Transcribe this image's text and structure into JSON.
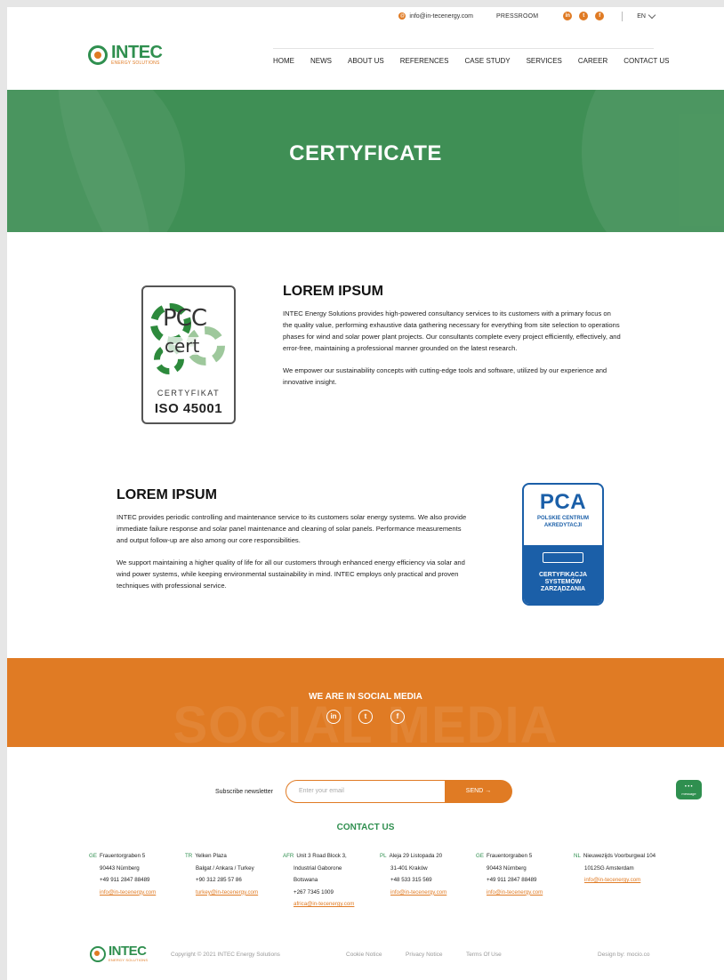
{
  "topbar": {
    "email": "info@in-tecenergy.com",
    "pressroom": "PRESSROOM",
    "social_icons": [
      "linkedin-icon",
      "twitter-icon",
      "facebook-icon"
    ],
    "language": "EN"
  },
  "logo": {
    "name": "INTEC",
    "tagline": "ENERGY SOLUTIONS"
  },
  "nav": [
    "HOME",
    "NEWS",
    "ABOUT US",
    "REFERENCES",
    "CASE STUDY",
    "SERVICES",
    "CAREER",
    "CONTACT US"
  ],
  "hero": {
    "title": "CERTYFICATE"
  },
  "cert_pcc": {
    "line1": "PCC",
    "line2": "cert",
    "label": "CERTYFIKAT",
    "standard": "ISO 45001"
  },
  "section1": {
    "heading": "LOREM IPSUM",
    "p1": "INTEC Energy Solutions provides high-powered consultancy services to its customers with a primary focus on the quality value, performing exhaustive data gathering necessary for everything from site selection to operations phases for wind and solar power plant projects. Our consultants complete every project efficiently, effectively, and error-free, maintaining a professional manner grounded on the latest research.",
    "p2": "We empower our sustainability concepts with cutting-edge tools and software, utilized by our experience and innovative insight."
  },
  "section2": {
    "heading": "LOREM IPSUM",
    "p1": "INTEC provides periodic controlling and maintenance service to its customers solar energy systems. We also provide immediate failure response and solar panel maintenance and cleaning of solar panels. Performance measurements and output follow-up are also among our core responsibilities.",
    "p2": "We support maintaining a higher quality of life for all our customers through enhanced energy efficiency via solar and wind power systems, while keeping environmental sustainability in mind. INTEC employs only practical and proven techniques with professional service."
  },
  "cert_pca": {
    "logo": "PCA",
    "name_line1": "POLSKIE CENTRUM",
    "name_line2": "AKREDYTACJI",
    "bottom_line1": "CERTYFIKACJA",
    "bottom_line2": "SYSTEMÓW",
    "bottom_line3": "ZARZĄDZANIA"
  },
  "social": {
    "background_text": "SOCIAL MEDIA",
    "title": "WE ARE IN SOCIAL MEDIA"
  },
  "newsletter": {
    "label": "Subscribe newsletter",
    "placeholder": "Enter your email",
    "button": "SEND →"
  },
  "chat": {
    "label": "message"
  },
  "contact": {
    "title": "CONTACT US",
    "offices": [
      {
        "code": "GE",
        "line1": "Frauentorgraben 5",
        "line2": "90443 Nürnberg",
        "line3": "+49 911 2847 88489",
        "email": "info@in-tecenergy.com"
      },
      {
        "code": "TR",
        "line1": "Yelken Plaza",
        "line2": "Balgat / Ankara / Turkey",
        "line3": "+90 312 285 57 86",
        "email": "turkey@in-tecenergy.com"
      },
      {
        "code": "AFR",
        "line1": "Unit 3 Road Block 3,",
        "line2": "Industrial Gaborone",
        "line3": "Botswana",
        "line4": "+267 7345 1009",
        "email": "africa@in-tecenergy.com"
      },
      {
        "code": "PL",
        "line1": "Aleja 29 Listopada 20",
        "line2": "31-401 Kraków",
        "line3": "+48 533 315 569",
        "email": "info@in-tecenergy.com"
      },
      {
        "code": "GE",
        "line1": "Frauentorgraben 5",
        "line2": "90443 Nürnberg",
        "line3": "+49 911 2847 88489",
        "email": "info@in-tecenergy.com"
      },
      {
        "code": "NL",
        "line1": "Nieuwezijds Voorburgwal 104",
        "line2": "1012SG Amsterdam",
        "email": "info@in-tecenergy.com"
      }
    ]
  },
  "footer": {
    "copyright": "Copyright © 2021 INTEC Energy Solutions",
    "links": [
      "Cookie Notice",
      "Privacy Notice",
      "Terms Of Use"
    ],
    "design": "Design by: mocio.co"
  },
  "colors": {
    "green": "#3f8f55",
    "orange": "#e07b24",
    "pca_blue": "#1b5fa8"
  }
}
